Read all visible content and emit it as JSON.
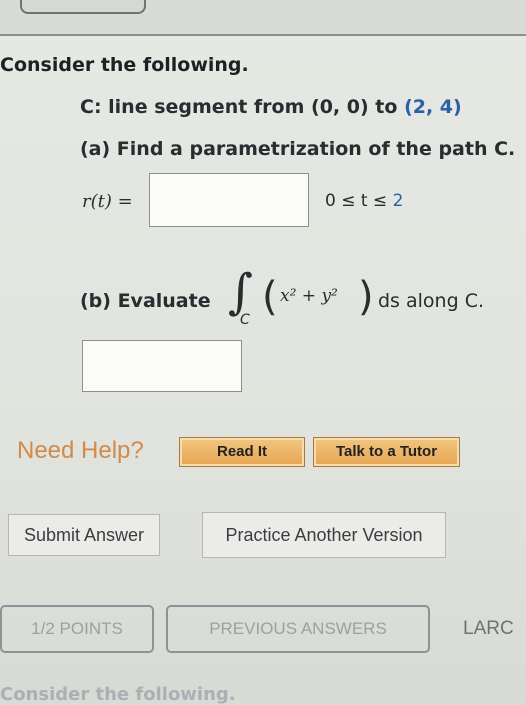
{
  "problem": {
    "intro": "Consider the following.",
    "path_prefix": "C: line segment from",
    "start_point": "(0, 0)",
    "to_word": "to",
    "end_point": "(2, 4)",
    "part_a": "(a) Find a parametrization of the path C.",
    "rt_label": "r(t) =",
    "range_prefix": "0 ≤ t ≤",
    "range_upper": "2",
    "part_b": "(b) Evaluate",
    "integral_sub": "C",
    "integrand": "x² + y²",
    "integral_suffix": "ds along C."
  },
  "help": {
    "need_help": "Need Help?",
    "read_it": "Read It",
    "talk_to_tutor": "Talk to a Tutor"
  },
  "actions": {
    "submit": "Submit Answer",
    "practice": "Practice Another Version"
  },
  "next": {
    "points": "1/2 POINTS",
    "previous_answers": "PREVIOUS ANSWERS",
    "partial_label": "LARC",
    "faded_intro": "Consider the following."
  }
}
